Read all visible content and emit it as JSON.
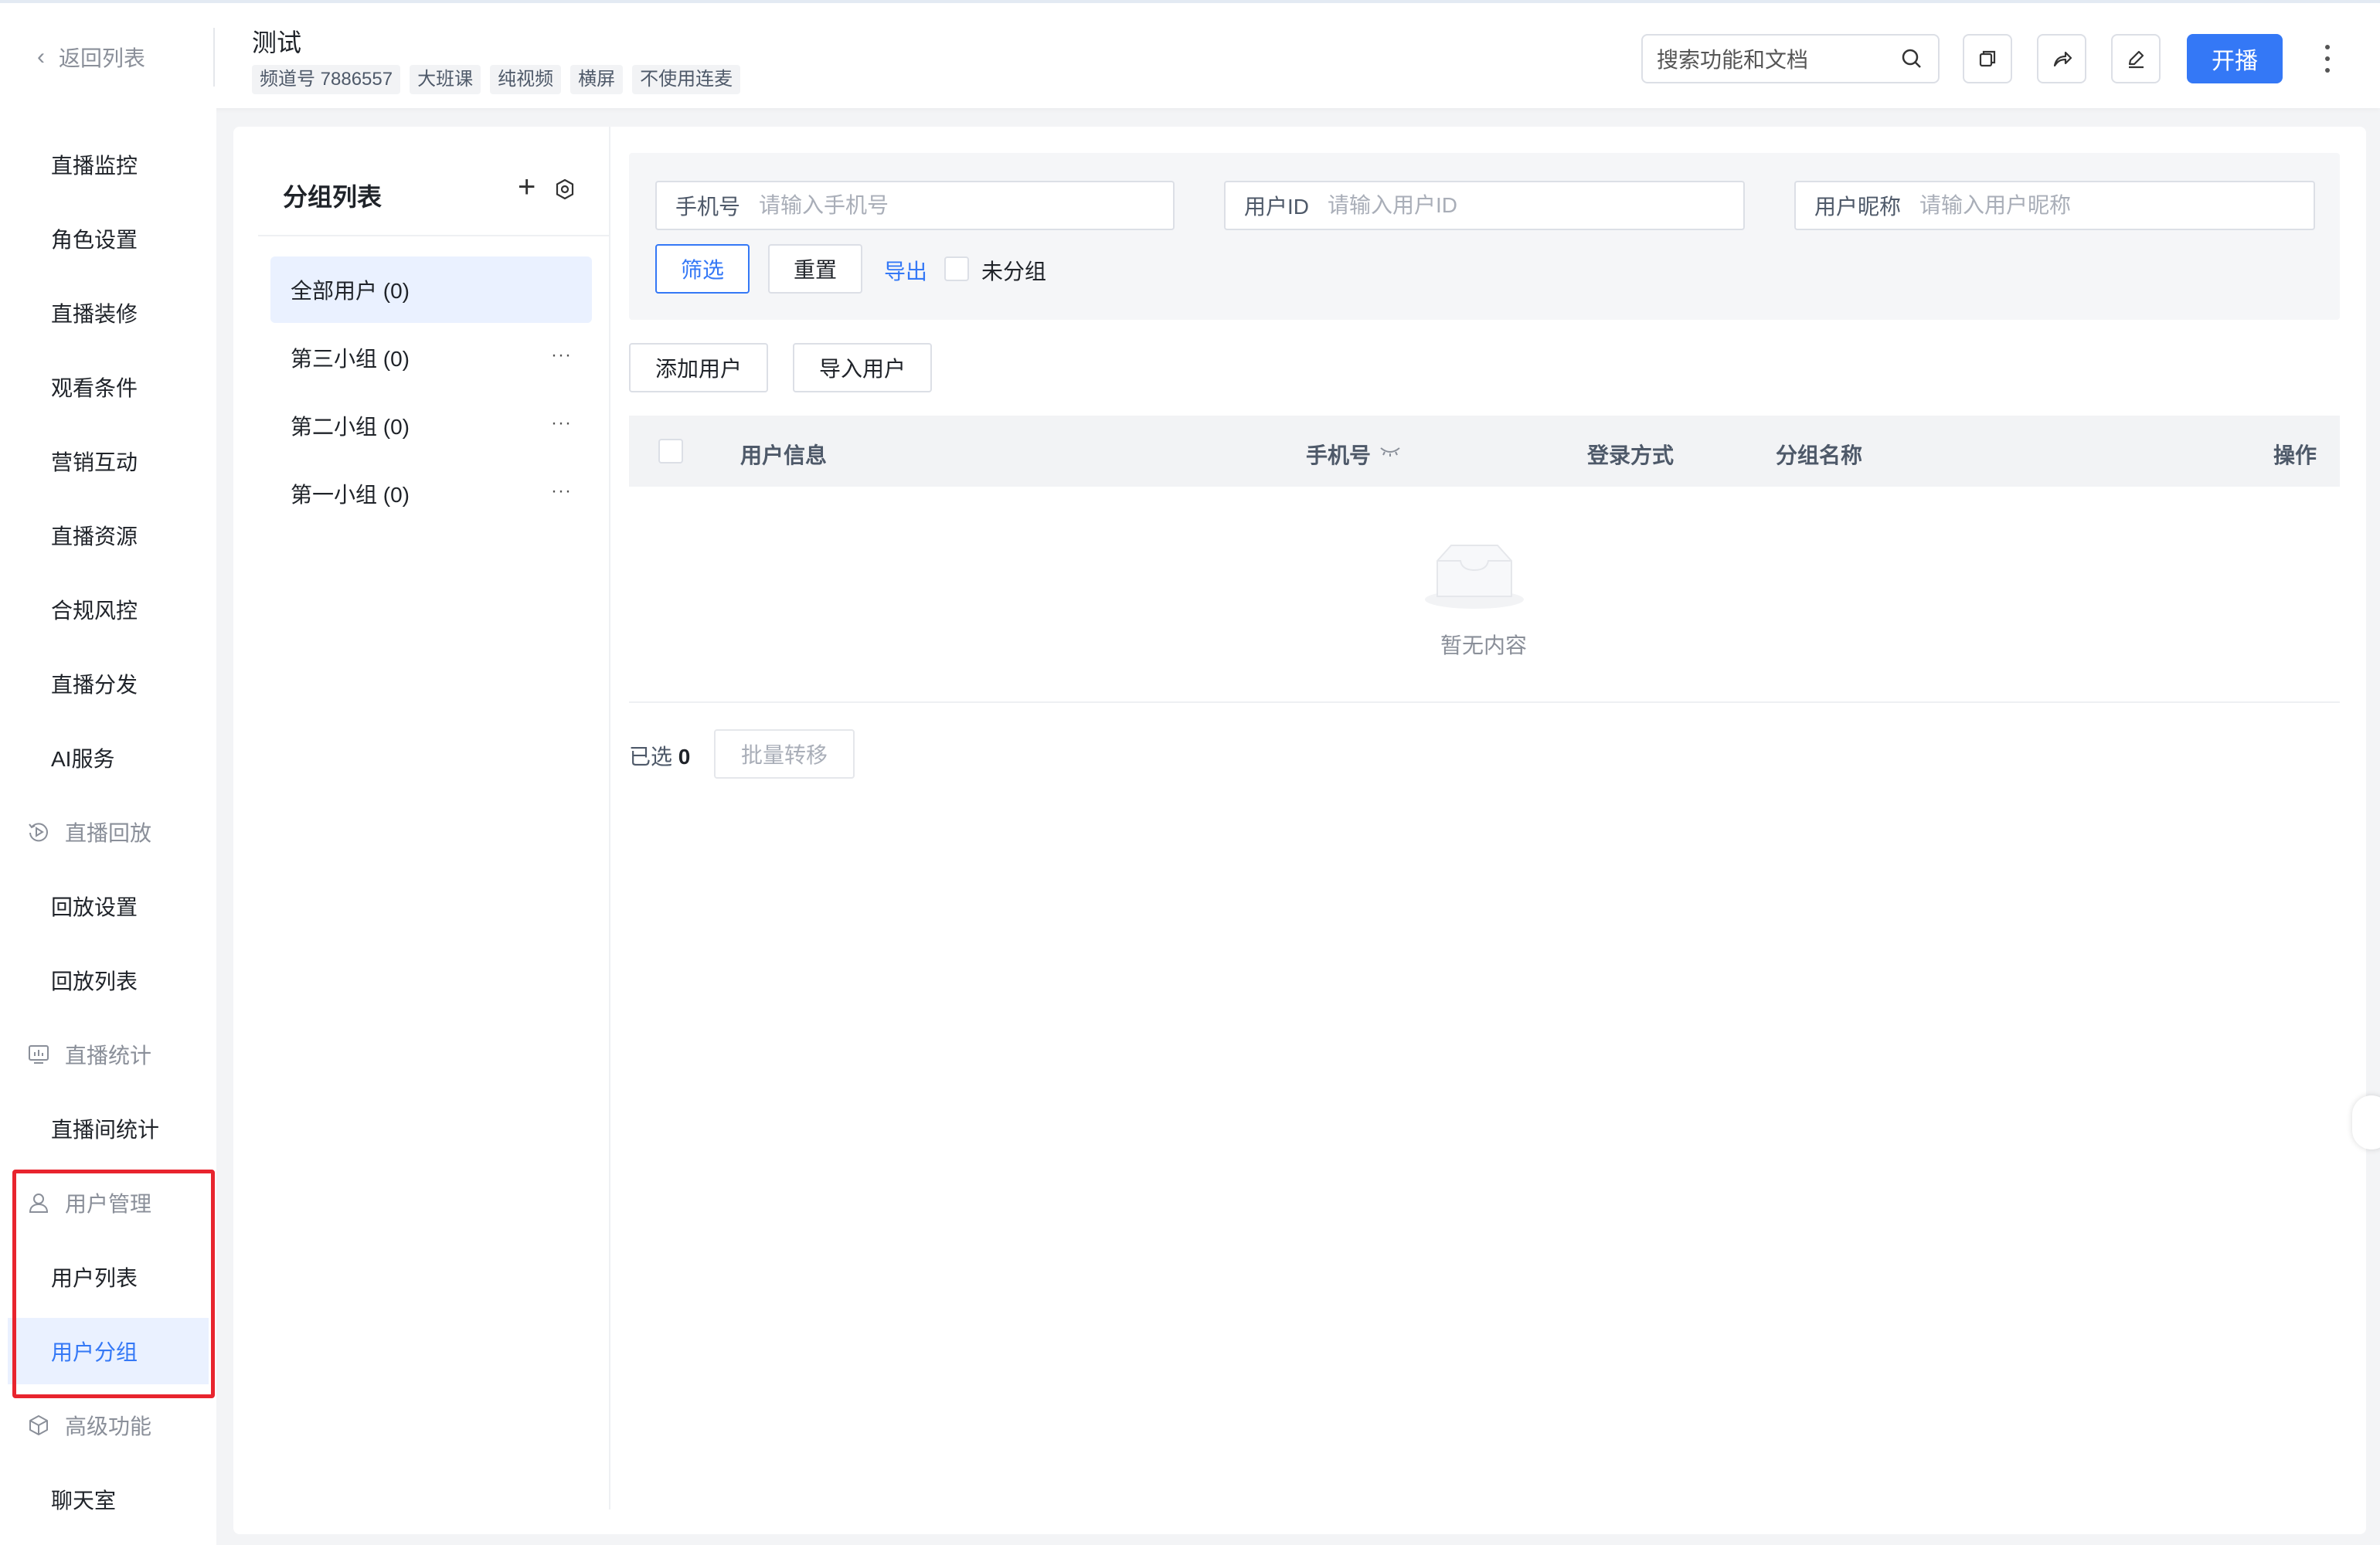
{
  "header": {
    "back_label": "返回列表",
    "title": "测试",
    "tags": [
      "频道号 7886557",
      "大班课",
      "纯视频",
      "横屏",
      "不使用连麦"
    ],
    "search_placeholder": "搜索功能和文档",
    "start_label": "开播"
  },
  "sidebar": {
    "items": [
      {
        "label": "直播监控",
        "type": "item"
      },
      {
        "label": "角色设置",
        "type": "item"
      },
      {
        "label": "直播装修",
        "type": "item"
      },
      {
        "label": "观看条件",
        "type": "item"
      },
      {
        "label": "营销互动",
        "type": "item"
      },
      {
        "label": "直播资源",
        "type": "item"
      },
      {
        "label": "合规风控",
        "type": "item"
      },
      {
        "label": "直播分发",
        "type": "item"
      },
      {
        "label": "AI服务",
        "type": "item"
      },
      {
        "label": "直播回放",
        "type": "group",
        "icon": "replay-icon"
      },
      {
        "label": "回放设置",
        "type": "item"
      },
      {
        "label": "回放列表",
        "type": "item"
      },
      {
        "label": "直播统计",
        "type": "group",
        "icon": "stats-icon"
      },
      {
        "label": "直播间统计",
        "type": "item"
      },
      {
        "label": "用户管理",
        "type": "group",
        "icon": "user-icon"
      },
      {
        "label": "用户列表",
        "type": "item"
      },
      {
        "label": "用户分组",
        "type": "item",
        "active": true
      },
      {
        "label": "高级功能",
        "type": "group",
        "icon": "cube-icon"
      },
      {
        "label": "聊天室",
        "type": "item"
      }
    ],
    "active_color": "#3478f6",
    "highlight_color": "#e8242e"
  },
  "groups": {
    "title": "分组列表",
    "items": [
      {
        "label": "全部用户 (0)",
        "active": true
      },
      {
        "label": "第三小组 (0)"
      },
      {
        "label": "第二小组 (0)"
      },
      {
        "label": "第一小组 (0)"
      }
    ]
  },
  "filter": {
    "phone_label": "手机号",
    "phone_placeholder": "请输入手机号",
    "userid_label": "用户ID",
    "userid_placeholder": "请输入用户ID",
    "nickname_label": "用户昵称",
    "nickname_placeholder": "请输入用户昵称",
    "filter_label": "筛选",
    "reset_label": "重置",
    "export_label": "导出",
    "ungrouped_label": "未分组"
  },
  "actions": {
    "add_user": "添加用户",
    "import_user": "导入用户"
  },
  "table": {
    "columns": [
      "用户信息",
      "手机号",
      "登录方式",
      "分组名称",
      "操作"
    ],
    "empty_text": "暂无内容"
  },
  "footer": {
    "selected_label": "已选",
    "selected_count": "0",
    "batch_transfer": "批量转移"
  }
}
